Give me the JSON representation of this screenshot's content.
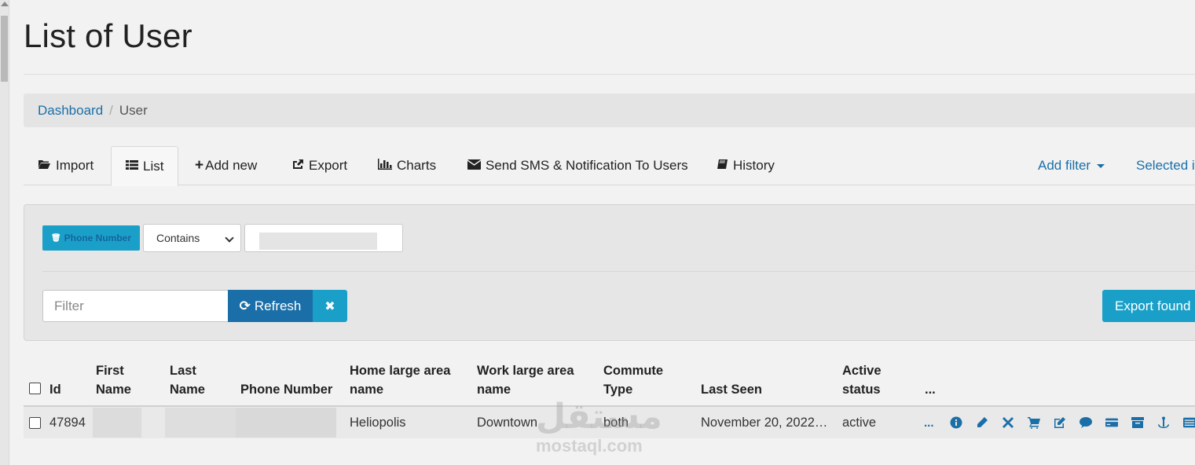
{
  "page": {
    "title": "List of User"
  },
  "breadcrumb": {
    "items": [
      "Dashboard",
      "User"
    ],
    "separator": "/"
  },
  "tabs": [
    {
      "label": "Import",
      "icon": "folder-open-icon"
    },
    {
      "label": "List",
      "icon": "list-icon",
      "active": true
    },
    {
      "label": "Add new",
      "icon": "plus-icon"
    },
    {
      "label": "Export",
      "icon": "share-icon"
    },
    {
      "label": "Charts",
      "icon": "bar-chart-icon"
    },
    {
      "label": "Send SMS & Notification To Users",
      "icon": "envelope-icon"
    },
    {
      "label": "History",
      "icon": "book-icon"
    }
  ],
  "right_tabs": {
    "add_filter": "Add filter",
    "selected": "Selected it"
  },
  "filter": {
    "field_chip": "Phone Number",
    "operator": "Contains",
    "search_placeholder": "Filter",
    "refresh_label": "Refresh",
    "clear_label": "✖",
    "export_label": "Export found U"
  },
  "table": {
    "columns": [
      "Id",
      "First Name",
      "Last Name",
      "Phone Number",
      "Home large area name",
      "Work large area name",
      "Commute Type",
      "Last Seen",
      "Active status",
      "..."
    ],
    "rows": [
      {
        "id": "47894",
        "first_name": "",
        "last_name": "",
        "phone": "",
        "home_area": "Heliopolis",
        "work_area": "Downtown",
        "commute": "both",
        "last_seen": "November 20, 2022…",
        "active": "active",
        "more": "..."
      }
    ],
    "row_actions": [
      "info-icon",
      "pencil-icon",
      "close-icon",
      "cart-icon",
      "edit-icon",
      "comment-icon",
      "credit-card-icon",
      "archive-icon",
      "anchor-icon",
      "list-alt-icon"
    ]
  },
  "watermark": {
    "arabic": "مستقل",
    "latin": "mostaql.com"
  },
  "colors": {
    "link": "#1b6fa8",
    "primary": "#1a6fa8",
    "info": "#1aa0c8",
    "background": "#f2f2f2"
  }
}
